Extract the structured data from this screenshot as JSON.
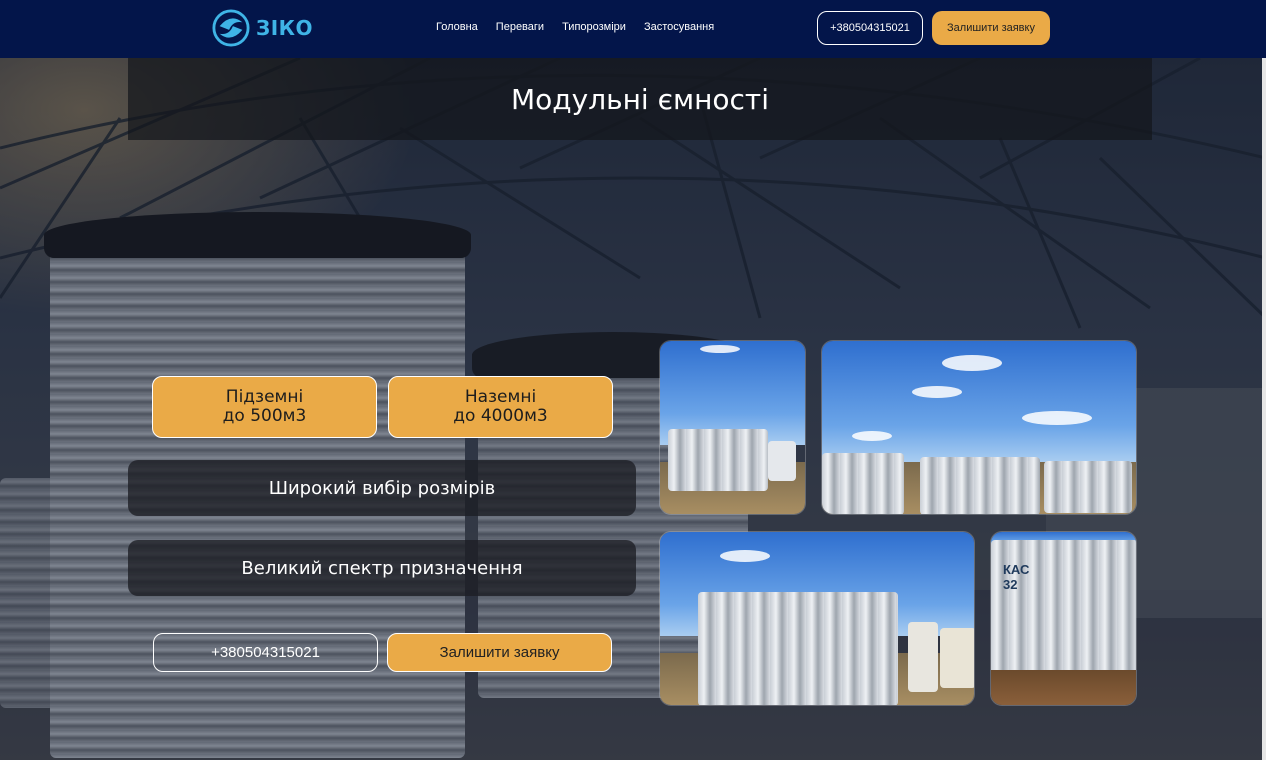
{
  "header": {
    "brand": "ЗІКО",
    "nav": [
      "Головна",
      "Переваги",
      "Типорозміри",
      "Застосування"
    ],
    "phone": "+380504315021",
    "cta": "Залишити заявку"
  },
  "hero": {
    "title": "Модульні ємності",
    "cards": [
      {
        "line1": "Підземні",
        "line2": "до 500м3"
      },
      {
        "line1": "Наземні",
        "line2": "до 4000м3"
      }
    ],
    "features": [
      "Широкий вибір розмірів",
      "Великий спектр призначення"
    ],
    "phone": "+380504315021",
    "cta": "Залишити заявку"
  },
  "gallery": {
    "photo4_label": [
      "КАС",
      "32"
    ]
  },
  "colors": {
    "header_bg": "#03154a",
    "accent": "#eaaa47",
    "logo_blue": "#3fb4e6"
  }
}
